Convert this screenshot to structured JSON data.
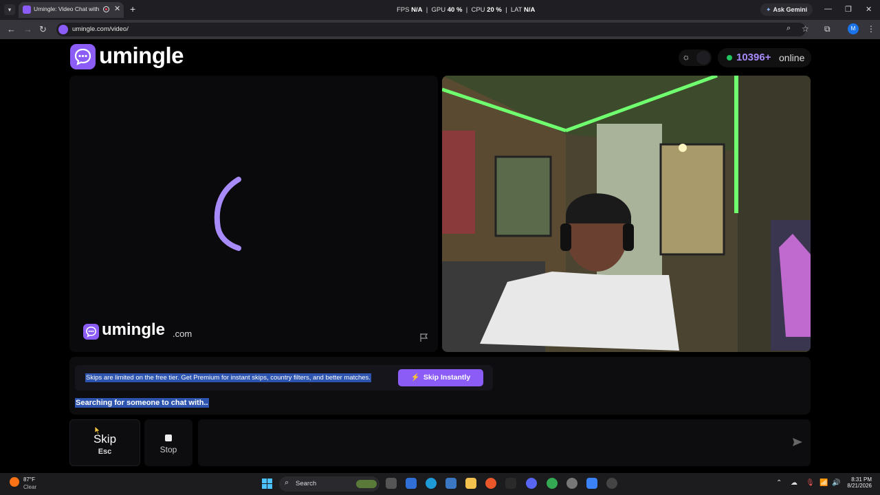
{
  "browser": {
    "tab_title": "Umingle: Video Chat with Strangers",
    "new_tab": "+",
    "url": "umingle.com/video/",
    "perf": {
      "fps_label": "FPS",
      "fps_value": "N/A",
      "gpu_label": "GPU",
      "gpu_value": "40 %",
      "cpu_label": "CPU",
      "cpu_value": "20 %",
      "lat_label": "LAT",
      "lat_value": "N/A"
    },
    "ask_gemini": "Ask Gemini",
    "profile_initial": "M"
  },
  "header": {
    "logo_text": "umingle",
    "online_count": "10396+",
    "online_label": "online"
  },
  "stranger_panel": {
    "watermark_text": "umingle",
    "watermark_domain": ".com"
  },
  "chat": {
    "notice": "Skips are limited on the free tier. Get Premium for instant skips, country filters, and better matches.",
    "skip_instantly": "Skip Instantly",
    "status": "Searching for someone to chat with.."
  },
  "controls": {
    "skip_label": "Skip",
    "skip_shortcut": "Esc",
    "stop_label": "Stop",
    "message_placeholder": ""
  },
  "taskbar": {
    "weather_temp": "87°F",
    "weather_cond": "Clear",
    "search_label": "Search",
    "time": "8:31 PM",
    "date": "8/21/2026"
  },
  "colors": {
    "brand": "#8b5cf6",
    "online_dot": "#22c55e",
    "selection": "#2d55b0"
  }
}
